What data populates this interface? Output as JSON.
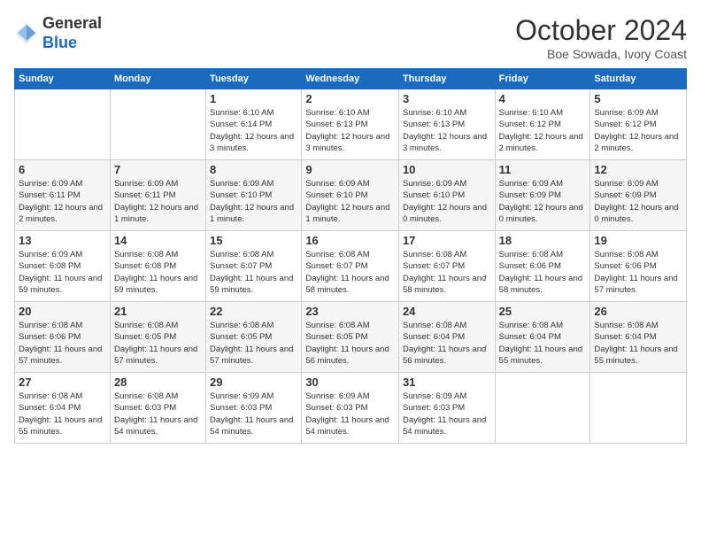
{
  "header": {
    "logo_line1": "General",
    "logo_line2": "Blue",
    "month_title": "October 2024",
    "location": "Boe Sowada, Ivory Coast"
  },
  "days_of_week": [
    "Sunday",
    "Monday",
    "Tuesday",
    "Wednesday",
    "Thursday",
    "Friday",
    "Saturday"
  ],
  "weeks": [
    [
      {
        "day": "",
        "info": ""
      },
      {
        "day": "",
        "info": ""
      },
      {
        "day": "1",
        "info": "Sunrise: 6:10 AM\nSunset: 6:14 PM\nDaylight: 12 hours and 3 minutes."
      },
      {
        "day": "2",
        "info": "Sunrise: 6:10 AM\nSunset: 6:13 PM\nDaylight: 12 hours and 3 minutes."
      },
      {
        "day": "3",
        "info": "Sunrise: 6:10 AM\nSunset: 6:13 PM\nDaylight: 12 hours and 3 minutes."
      },
      {
        "day": "4",
        "info": "Sunrise: 6:10 AM\nSunset: 6:12 PM\nDaylight: 12 hours and 2 minutes."
      },
      {
        "day": "5",
        "info": "Sunrise: 6:09 AM\nSunset: 6:12 PM\nDaylight: 12 hours and 2 minutes."
      }
    ],
    [
      {
        "day": "6",
        "info": "Sunrise: 6:09 AM\nSunset: 6:11 PM\nDaylight: 12 hours and 2 minutes."
      },
      {
        "day": "7",
        "info": "Sunrise: 6:09 AM\nSunset: 6:11 PM\nDaylight: 12 hours and 1 minute."
      },
      {
        "day": "8",
        "info": "Sunrise: 6:09 AM\nSunset: 6:10 PM\nDaylight: 12 hours and 1 minute."
      },
      {
        "day": "9",
        "info": "Sunrise: 6:09 AM\nSunset: 6:10 PM\nDaylight: 12 hours and 1 minute."
      },
      {
        "day": "10",
        "info": "Sunrise: 6:09 AM\nSunset: 6:10 PM\nDaylight: 12 hours and 0 minutes."
      },
      {
        "day": "11",
        "info": "Sunrise: 6:09 AM\nSunset: 6:09 PM\nDaylight: 12 hours and 0 minutes."
      },
      {
        "day": "12",
        "info": "Sunrise: 6:09 AM\nSunset: 6:09 PM\nDaylight: 12 hours and 0 minutes."
      }
    ],
    [
      {
        "day": "13",
        "info": "Sunrise: 6:09 AM\nSunset: 6:08 PM\nDaylight: 11 hours and 59 minutes."
      },
      {
        "day": "14",
        "info": "Sunrise: 6:08 AM\nSunset: 6:08 PM\nDaylight: 11 hours and 59 minutes."
      },
      {
        "day": "15",
        "info": "Sunrise: 6:08 AM\nSunset: 6:07 PM\nDaylight: 11 hours and 59 minutes."
      },
      {
        "day": "16",
        "info": "Sunrise: 6:08 AM\nSunset: 6:07 PM\nDaylight: 11 hours and 58 minutes."
      },
      {
        "day": "17",
        "info": "Sunrise: 6:08 AM\nSunset: 6:07 PM\nDaylight: 11 hours and 58 minutes."
      },
      {
        "day": "18",
        "info": "Sunrise: 6:08 AM\nSunset: 6:06 PM\nDaylight: 11 hours and 58 minutes."
      },
      {
        "day": "19",
        "info": "Sunrise: 6:08 AM\nSunset: 6:06 PM\nDaylight: 11 hours and 57 minutes."
      }
    ],
    [
      {
        "day": "20",
        "info": "Sunrise: 6:08 AM\nSunset: 6:06 PM\nDaylight: 11 hours and 57 minutes."
      },
      {
        "day": "21",
        "info": "Sunrise: 6:08 AM\nSunset: 6:05 PM\nDaylight: 11 hours and 57 minutes."
      },
      {
        "day": "22",
        "info": "Sunrise: 6:08 AM\nSunset: 6:05 PM\nDaylight: 11 hours and 57 minutes."
      },
      {
        "day": "23",
        "info": "Sunrise: 6:08 AM\nSunset: 6:05 PM\nDaylight: 11 hours and 56 minutes."
      },
      {
        "day": "24",
        "info": "Sunrise: 6:08 AM\nSunset: 6:04 PM\nDaylight: 11 hours and 56 minutes."
      },
      {
        "day": "25",
        "info": "Sunrise: 6:08 AM\nSunset: 6:04 PM\nDaylight: 11 hours and 55 minutes."
      },
      {
        "day": "26",
        "info": "Sunrise: 6:08 AM\nSunset: 6:04 PM\nDaylight: 11 hours and 55 minutes."
      }
    ],
    [
      {
        "day": "27",
        "info": "Sunrise: 6:08 AM\nSunset: 6:04 PM\nDaylight: 11 hours and 55 minutes."
      },
      {
        "day": "28",
        "info": "Sunrise: 6:08 AM\nSunset: 6:03 PM\nDaylight: 11 hours and 54 minutes."
      },
      {
        "day": "29",
        "info": "Sunrise: 6:09 AM\nSunset: 6:03 PM\nDaylight: 11 hours and 54 minutes."
      },
      {
        "day": "30",
        "info": "Sunrise: 6:09 AM\nSunset: 6:03 PM\nDaylight: 11 hours and 54 minutes."
      },
      {
        "day": "31",
        "info": "Sunrise: 6:09 AM\nSunset: 6:03 PM\nDaylight: 11 hours and 54 minutes."
      },
      {
        "day": "",
        "info": ""
      },
      {
        "day": "",
        "info": ""
      }
    ]
  ]
}
